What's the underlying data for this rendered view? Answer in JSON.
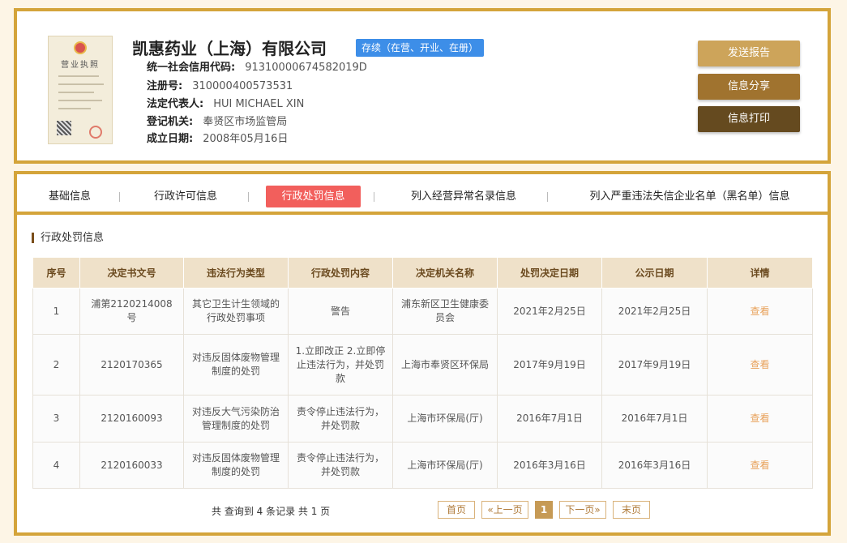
{
  "company": {
    "name": "凯惠药业（上海）有限公司",
    "status": "存续（在营、开业、在册）",
    "license_title": "营业执照",
    "fields": [
      {
        "label": "统一社会信用代码:",
        "value": "91310000674582019D"
      },
      {
        "label": "注册号:",
        "value": "310000400573531"
      },
      {
        "label": "法定代表人:",
        "value": "HUI MICHAEL XIN"
      },
      {
        "label": "登记机关:",
        "value": "奉贤区市场监管局"
      },
      {
        "label": "成立日期:",
        "value": "2008年05月16日"
      }
    ]
  },
  "actions": {
    "send_report": "发送报告",
    "share": "信息分享",
    "print": "信息打印"
  },
  "tabs": [
    {
      "label": "基础信息",
      "active": false
    },
    {
      "label": "行政许可信息",
      "active": false
    },
    {
      "label": "行政处罚信息",
      "active": true
    },
    {
      "label": "列入经营异常名录信息",
      "active": false
    },
    {
      "label": "列入严重违法失信企业名单（黑名单）信息",
      "active": false
    }
  ],
  "section_title": "行政处罚信息",
  "table": {
    "headers": [
      "序号",
      "决定书文号",
      "违法行为类型",
      "行政处罚内容",
      "决定机关名称",
      "处罚决定日期",
      "公示日期",
      "详情"
    ],
    "rows": [
      [
        "1",
        "浦第2120214008号",
        "其它卫生计生领域的行政处罚事项",
        "警告",
        "浦东新区卫生健康委员会",
        "2021年2月25日",
        "2021年2月25日",
        "查看"
      ],
      [
        "2",
        "2120170365",
        "对违反固体废物管理制度的处罚",
        "1.立即改正 2.立即停止违法行为，并处罚款",
        "上海市奉贤区环保局",
        "2017年9月19日",
        "2017年9月19日",
        "查看"
      ],
      [
        "3",
        "2120160093",
        "对违反大气污染防治管理制度的处罚",
        "责令停止违法行为，并处罚款",
        "上海市环保局(厅)",
        "2016年7月1日",
        "2016年7月1日",
        "查看"
      ],
      [
        "4",
        "2120160033",
        "对违反固体废物管理制度的处罚",
        "责令停止违法行为，并处罚款",
        "上海市环保局(厅)",
        "2016年3月16日",
        "2016年3月16日",
        "查看"
      ]
    ]
  },
  "pagination": {
    "summary": "共 查询到 4 条记录 共 1 页",
    "first": "首页",
    "prev": "«上一页",
    "current": "1",
    "next": "下一页»",
    "last": "末页"
  },
  "colors": {
    "border_gold": "#d4a43a",
    "active_tab": "#f25f5c",
    "status_badge": "#3d8ee8",
    "btn_send": "#cda45a",
    "btn_share": "#a0732f",
    "btn_print": "#654a1f",
    "link": "#e8a15a"
  }
}
